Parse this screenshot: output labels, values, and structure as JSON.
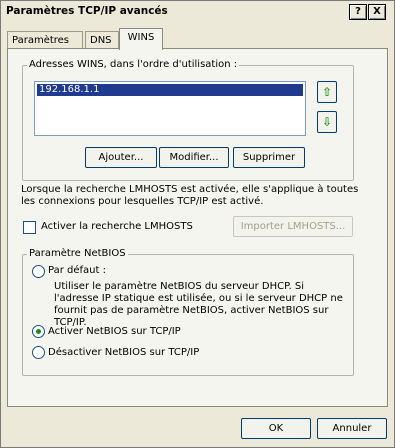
{
  "window": {
    "title": "Paramètres TCP/IP avancés",
    "help_button": "?",
    "close_button": "X"
  },
  "tabs": [
    {
      "label": "Paramètres IP",
      "active": false
    },
    {
      "label": "DNS",
      "active": false
    },
    {
      "label": "WINS",
      "active": true
    }
  ],
  "wins": {
    "group_label": "Adresses WINS, dans l'ordre d'utilisation :",
    "addresses": [
      "192.168.1.1"
    ],
    "up_icon": "green-up-arrow-icon",
    "down_icon": "green-down-arrow-icon",
    "buttons": {
      "add": "Ajouter...",
      "modify": "Modifier...",
      "remove": "Supprimer"
    }
  },
  "lmhosts": {
    "description": "Lorsque la recherche LMHOSTS est activée, elle s'applique à toutes les connexions pour lesquelles TCP/IP est activé.",
    "checkbox_label": "Activer la recherche LMHOSTS",
    "checked": false,
    "import_button": "Importer LMHOSTS..."
  },
  "netbios": {
    "group_label": "Paramètre NetBIOS",
    "options": [
      {
        "label": "Par défaut :",
        "selected": false
      },
      {
        "label": "Activer NetBIOS sur TCP/IP",
        "selected": true
      },
      {
        "label": "Désactiver NetBIOS sur TCP/IP",
        "selected": false
      }
    ],
    "default_description": "Utiliser le paramètre NetBIOS du serveur DHCP. Si l'adresse IP statique est utilisée, ou si le serveur DHCP ne fournit pas de paramètre NetBIOS, activer NetBIOS sur TCP/IP."
  },
  "footer": {
    "ok": "OK",
    "cancel": "Annuler"
  },
  "colors": {
    "selection": "#1f3a8f",
    "dialog_bg": "#ece9d8",
    "panel_bg": "#f5f5ef"
  }
}
